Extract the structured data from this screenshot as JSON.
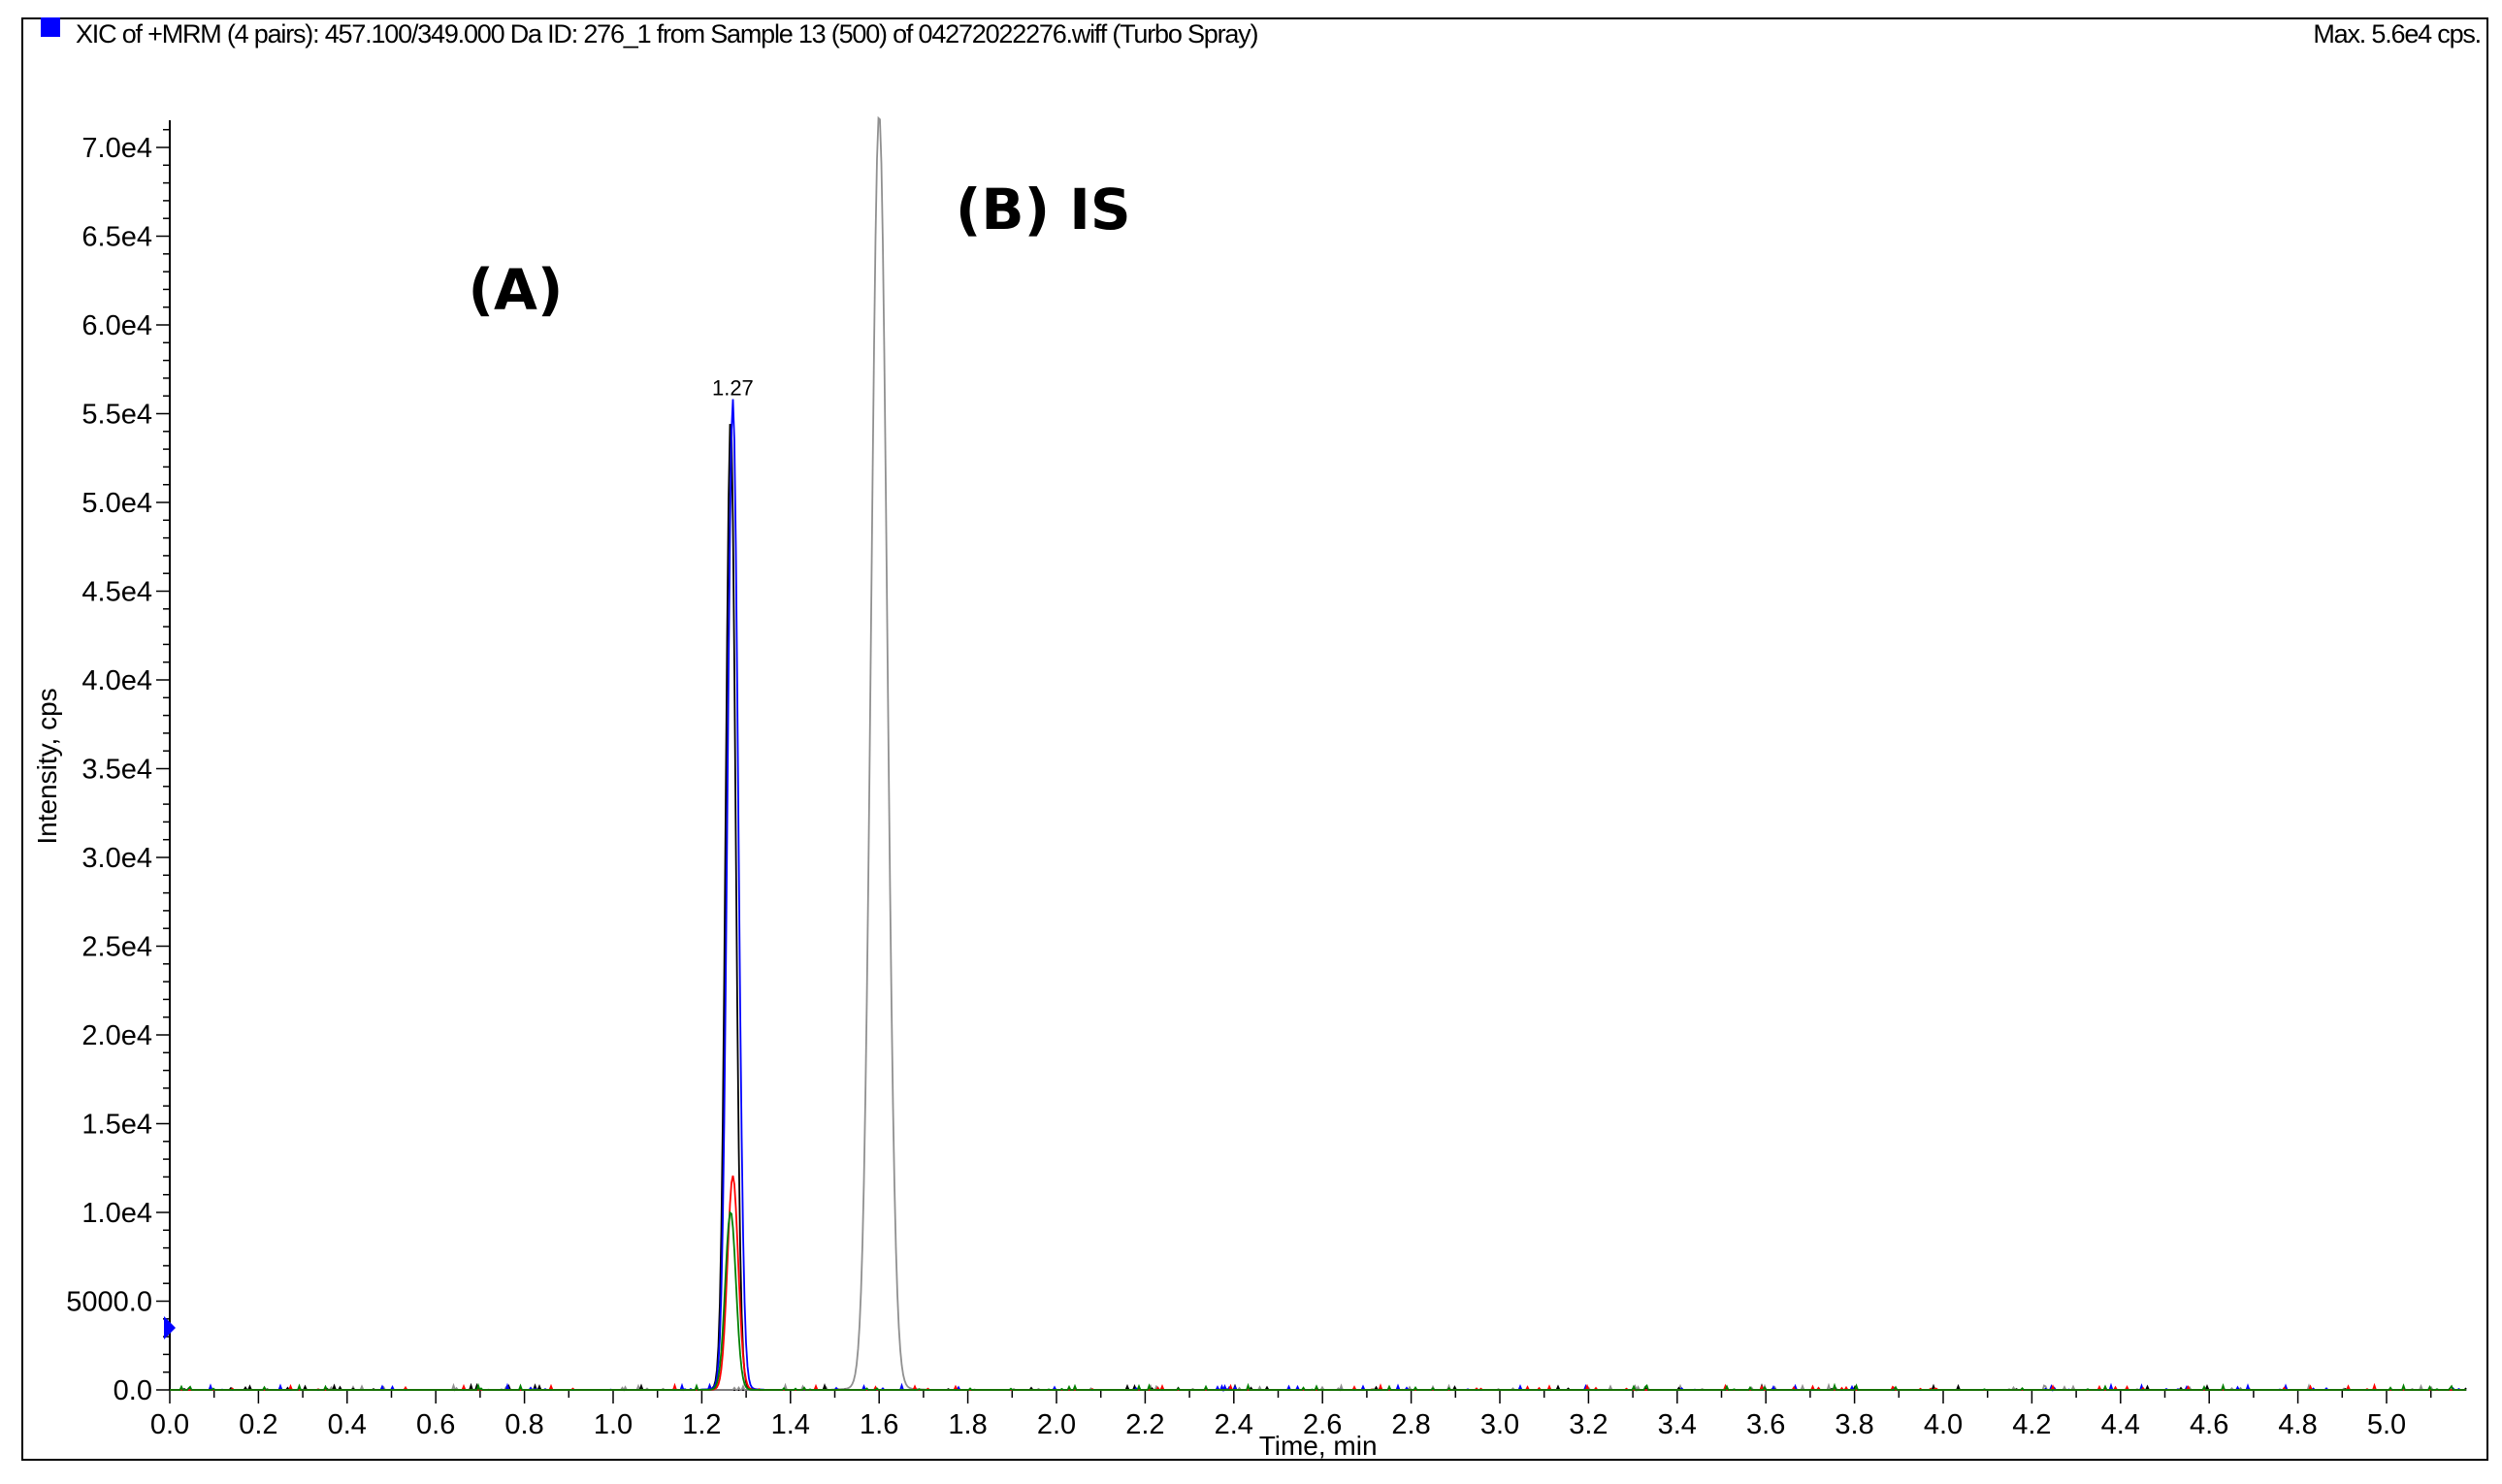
{
  "header": {
    "title": "XIC of +MRM (4 pairs): 457.100/349.000 Da ID: 276_1 from Sample 13 (500) of 04272022276.wiff (Turbo Spray)",
    "max_label": "Max. 5.6e4 cps."
  },
  "chart_data": {
    "type": "line",
    "title": "XIC of +MRM (4 pairs): 457.100/349.000 Da ID: 276_1 from Sample 13 (500) of 04272022276.wiff (Turbo Spray)",
    "xlabel": "Time, min",
    "ylabel": "Intensity, cps",
    "xlim": [
      0.0,
      5.18
    ],
    "ylim": [
      0,
      71500
    ],
    "xticks": [
      "0.0",
      "0.2",
      "0.4",
      "0.6",
      "0.8",
      "1.0",
      "1.2",
      "1.4",
      "1.6",
      "1.8",
      "2.0",
      "2.2",
      "2.4",
      "2.6",
      "2.8",
      "3.0",
      "3.2",
      "3.4",
      "3.6",
      "3.8",
      "4.0",
      "4.2",
      "4.4",
      "4.6",
      "4.8",
      "5.0"
    ],
    "yticks": [
      {
        "v": 0,
        "label": "0.0"
      },
      {
        "v": 5000,
        "label": "5000.0"
      },
      {
        "v": 10000,
        "label": "1.0e4"
      },
      {
        "v": 15000,
        "label": "1.5e4"
      },
      {
        "v": 20000,
        "label": "2.0e4"
      },
      {
        "v": 25000,
        "label": "2.5e4"
      },
      {
        "v": 30000,
        "label": "3.0e4"
      },
      {
        "v": 35000,
        "label": "3.5e4"
      },
      {
        "v": 40000,
        "label": "4.0e4"
      },
      {
        "v": 45000,
        "label": "4.5e4"
      },
      {
        "v": 50000,
        "label": "5.0e4"
      },
      {
        "v": 55000,
        "label": "5.5e4"
      },
      {
        "v": 60000,
        "label": "6.0e4"
      },
      {
        "v": 65000,
        "label": "6.5e4"
      },
      {
        "v": 70000,
        "label": "7.0e4"
      }
    ],
    "series": [
      {
        "name": "IS (gray)",
        "color": "#909090",
        "peak_time": 1.6,
        "peak_height": 71500,
        "width": 0.018
      },
      {
        "name": "analyte trace black",
        "color": "#000000",
        "peak_time": 1.265,
        "peak_height": 54500,
        "width": 0.011
      },
      {
        "name": "analyte 457.100/349.000 (blue)",
        "color": "#0000ff",
        "peak_time": 1.27,
        "peak_height": 55500,
        "width": 0.012
      },
      {
        "name": "red transition",
        "color": "#ff0000",
        "peak_time": 1.27,
        "peak_height": 12000,
        "width": 0.012
      },
      {
        "name": "green transition",
        "color": "#008000",
        "peak_time": 1.265,
        "peak_height": 10000,
        "width": 0.012
      }
    ],
    "annotations": [
      {
        "text": "1.27",
        "x": 1.27,
        "y": 55500
      },
      {
        "text": "(A)",
        "x": 0.78,
        "y": 62000
      },
      {
        "text": "(B) IS",
        "x": 1.97,
        "y": 66500
      }
    ],
    "threshold_marker_value": 3500,
    "grid": false,
    "legend": "none"
  }
}
